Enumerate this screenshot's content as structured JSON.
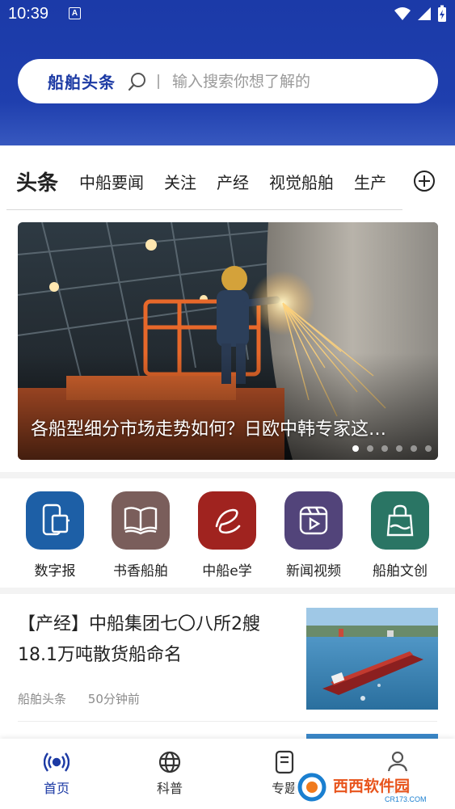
{
  "status_bar": {
    "time": "10:39",
    "notification_badge": "A"
  },
  "search": {
    "brand": "船舶头条",
    "placeholder": "输入搜索你想了解的"
  },
  "tabs": [
    {
      "label": "头条",
      "active": true
    },
    {
      "label": "中船要闻"
    },
    {
      "label": "关注"
    },
    {
      "label": "产经"
    },
    {
      "label": "视觉船舶"
    },
    {
      "label": "生产"
    }
  ],
  "banner": {
    "title": "各船型细分市场走势如何？日欧中韩专家这…",
    "slide_count": 6,
    "active_slide": 1
  },
  "quick_links": [
    {
      "label": "数字报",
      "icon": "digital-newspaper-icon",
      "color": "#1d5fa6"
    },
    {
      "label": "书香船舶",
      "icon": "book-icon",
      "color": "#7a5e5b"
    },
    {
      "label": "中船e学",
      "icon": "e-learning-icon",
      "color": "#a0231f"
    },
    {
      "label": "新闻视频",
      "icon": "video-icon",
      "color": "#52447a"
    },
    {
      "label": "船舶文创",
      "icon": "shopping-bag-icon",
      "color": "#2a7564"
    }
  ],
  "news": [
    {
      "title": "【产经】中船集团七〇八所2艘18.1万吨散货船命名",
      "source": "船舶头条",
      "time": "50分钟前"
    }
  ],
  "bottom_nav": [
    {
      "label": "首页",
      "icon": "broadcast-icon",
      "active": true
    },
    {
      "label": "科普",
      "icon": "globe-icon"
    },
    {
      "label": "专题",
      "icon": "document-icon"
    },
    {
      "label": "我的",
      "icon": "user-icon"
    }
  ],
  "watermark": {
    "text": "西西软件园",
    "sub": "CR173.COM"
  },
  "colors": {
    "brand_blue": "#1c3aa4",
    "header_blue": "#1f3fae"
  }
}
